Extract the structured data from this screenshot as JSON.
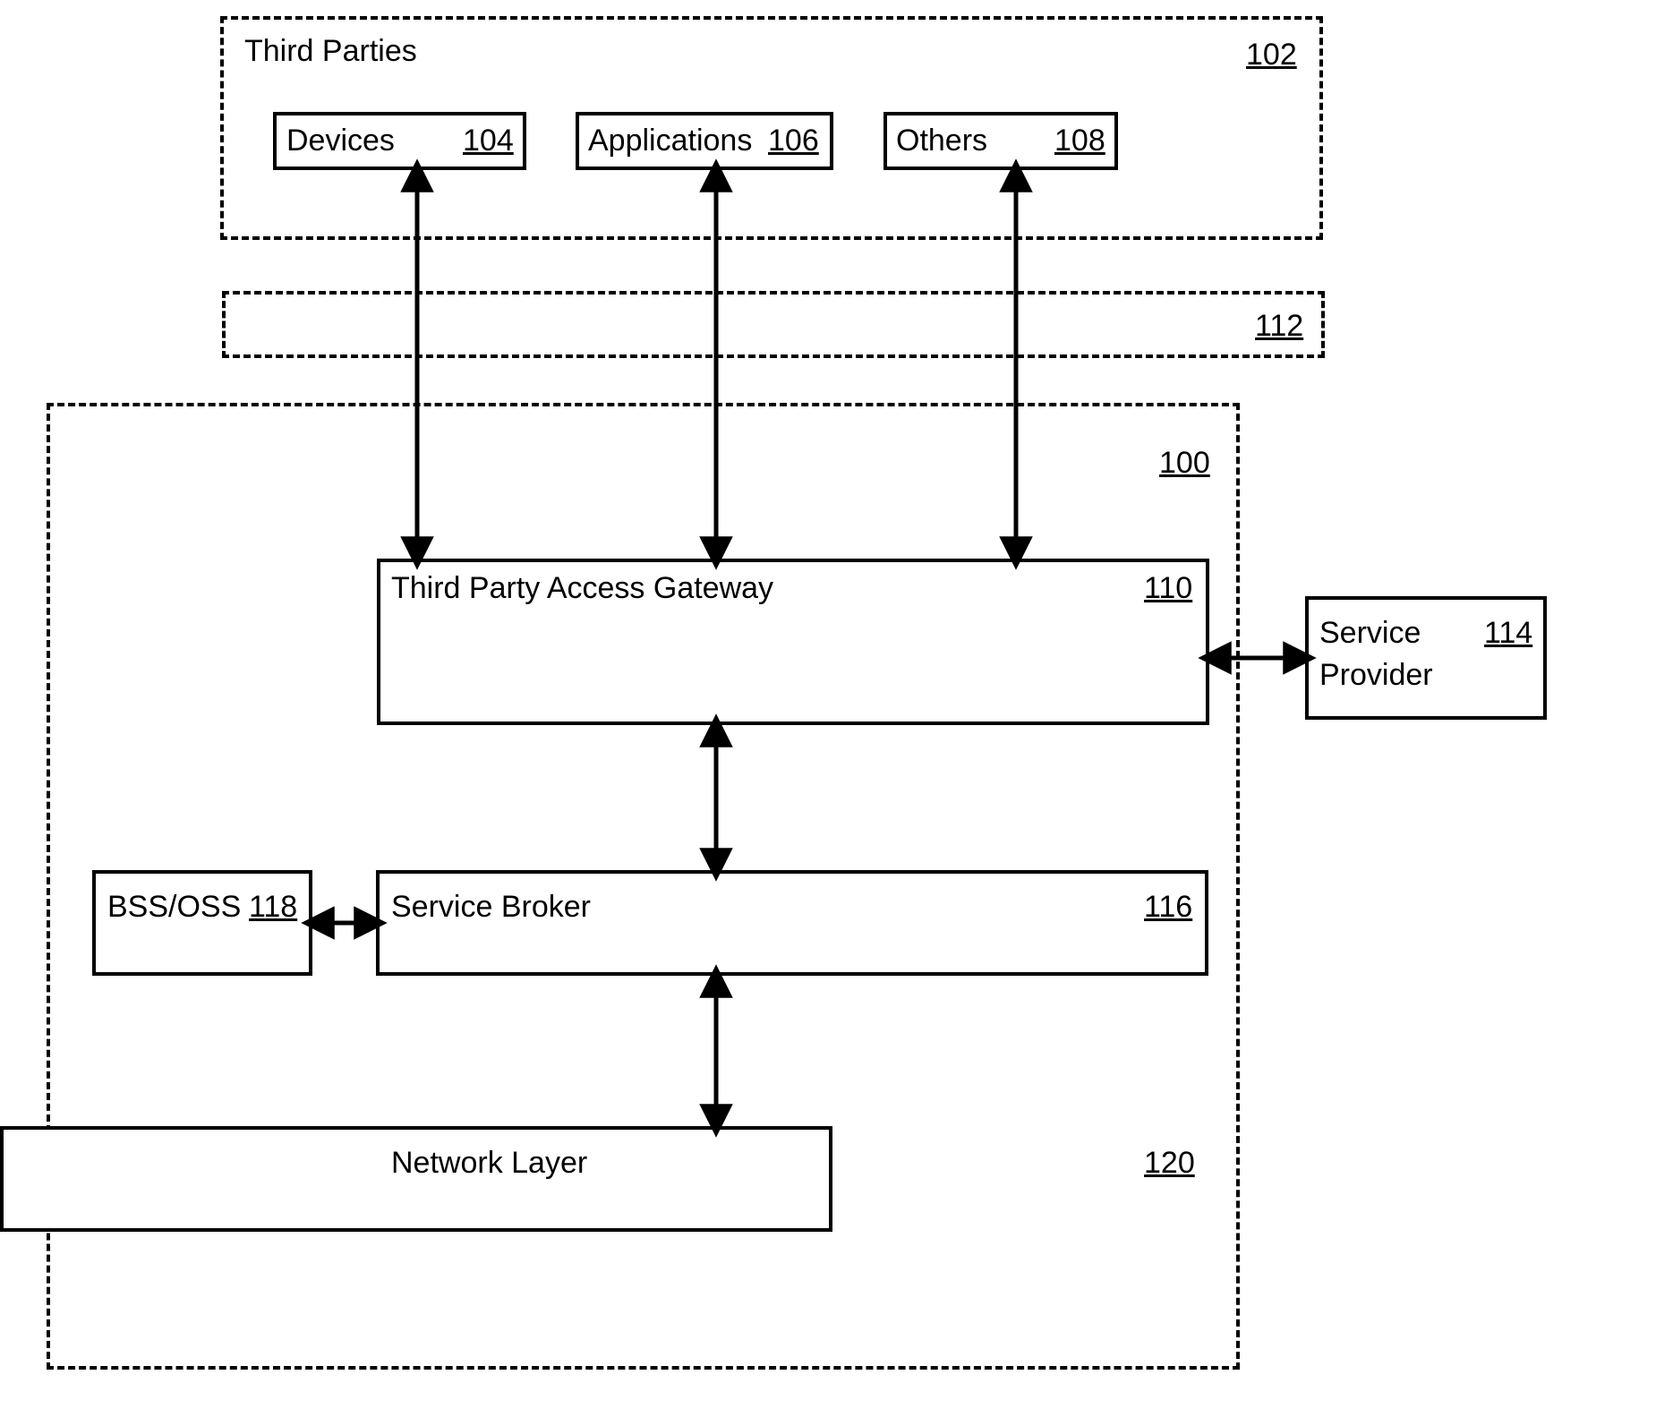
{
  "thirdParties": {
    "title": "Third Parties",
    "ref": "102",
    "devices": {
      "label": "Devices",
      "ref": "104"
    },
    "applications": {
      "label": "Applications",
      "ref": "106"
    },
    "others": {
      "label": "Others",
      "ref": "108"
    }
  },
  "interfaceBar": {
    "ref": "112"
  },
  "system": {
    "ref": "100",
    "gateway": {
      "label": "Third Party Access Gateway",
      "ref": "110"
    },
    "broker": {
      "label": "Service Broker",
      "ref": "116"
    },
    "network": {
      "label": "Network Layer",
      "ref": "120"
    }
  },
  "bssoss": {
    "label": "BSS/OSS",
    "ref": "118"
  },
  "serviceProvider": {
    "label1": "Service",
    "label2": "Provider",
    "ref": "114"
  }
}
